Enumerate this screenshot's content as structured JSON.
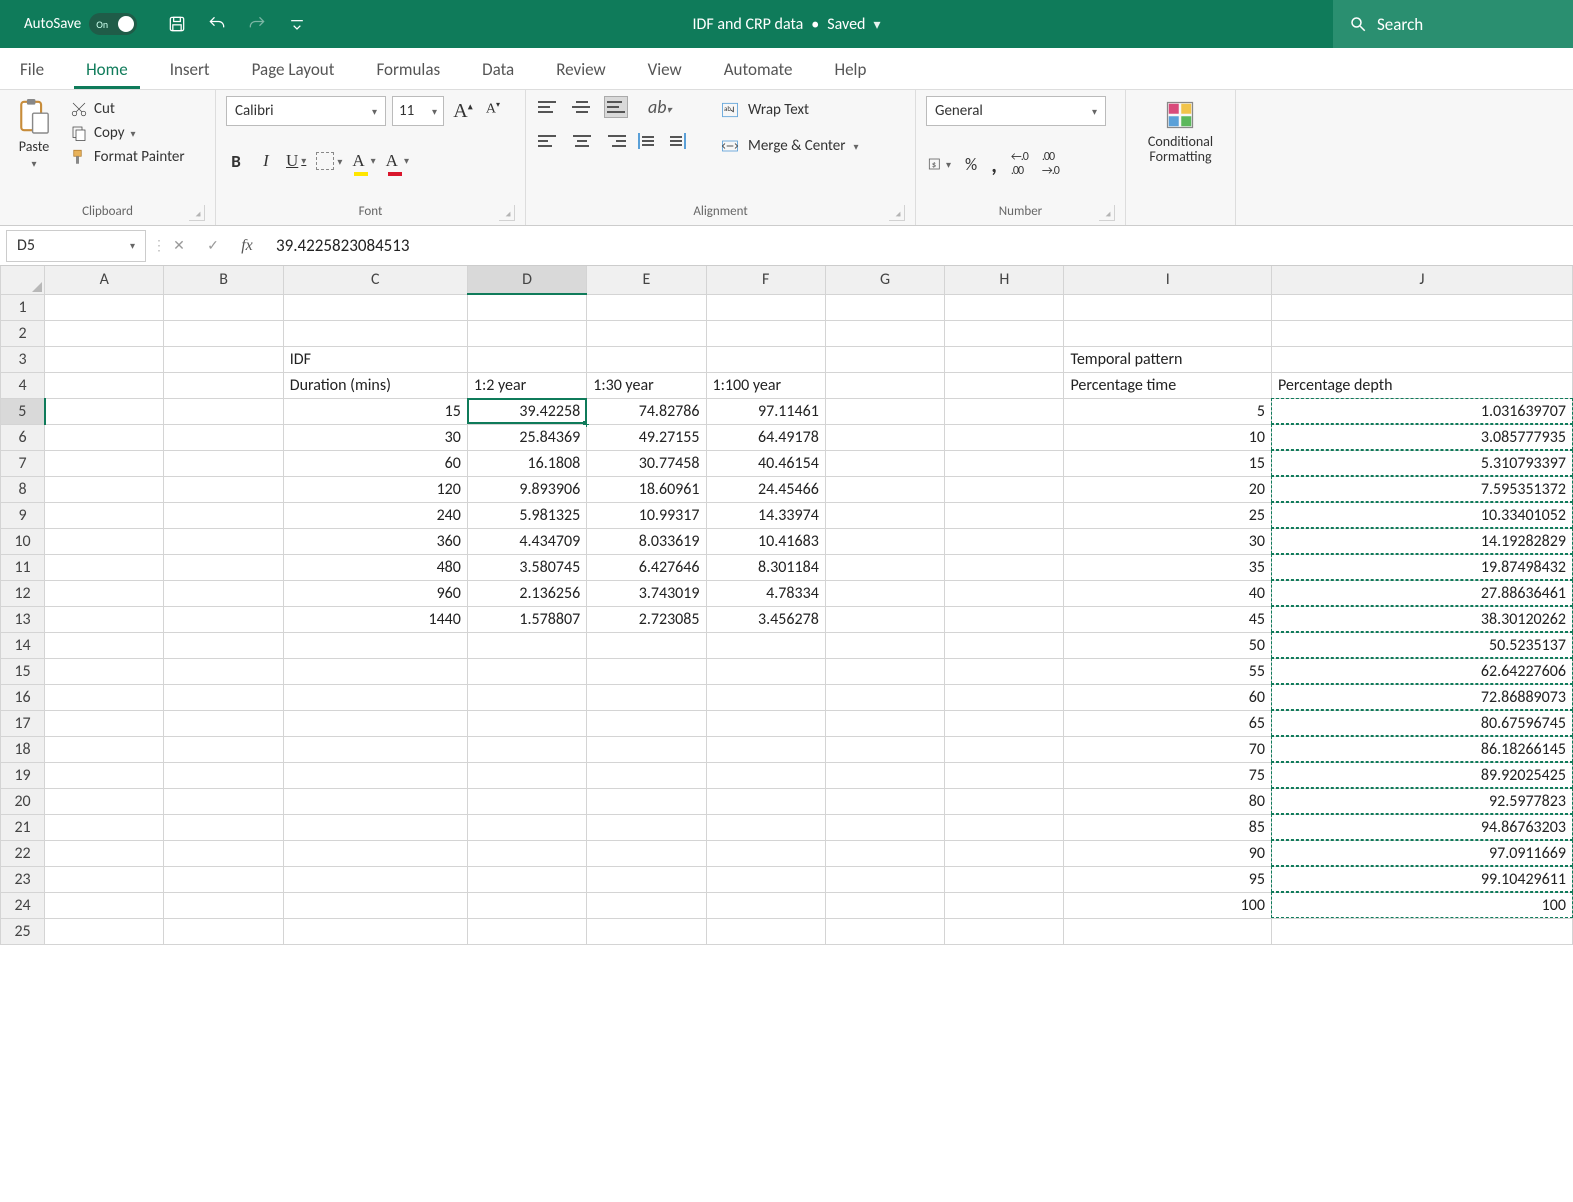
{
  "title_bar": {
    "autosave_label": "AutoSave",
    "autosave_on": "On",
    "doc_name": "IDF and CRP data",
    "doc_status": "Saved",
    "search_placeholder": "Search"
  },
  "ribbon_tabs": [
    "File",
    "Home",
    "Insert",
    "Page Layout",
    "Formulas",
    "Data",
    "Review",
    "View",
    "Automate",
    "Help"
  ],
  "active_tab": "Home",
  "ribbon": {
    "clipboard": {
      "paste": "Paste",
      "cut": "Cut",
      "copy": "Copy",
      "format_painter": "Format Painter",
      "group_label": "Clipboard"
    },
    "font": {
      "name": "Calibri",
      "size": "11",
      "group_label": "Font"
    },
    "alignment": {
      "wrap": "Wrap Text",
      "merge": "Merge & Center",
      "group_label": "Alignment"
    },
    "number": {
      "format": "General",
      "group_label": "Number"
    },
    "cond": {
      "label": "Conditional\nFormatting"
    }
  },
  "formula_bar": {
    "name_box": "D5",
    "value": "39.4225823084513"
  },
  "columns": [
    "A",
    "B",
    "C",
    "D",
    "E",
    "F",
    "G",
    "H",
    "I",
    "J"
  ],
  "selected_col": "D",
  "selected_row": 5,
  "rows": [
    {
      "r": 1
    },
    {
      "r": 2
    },
    {
      "r": 3,
      "C": {
        "v": "IDF",
        "t": true
      },
      "I": {
        "v": "Temporal pattern",
        "t": true
      }
    },
    {
      "r": 4,
      "C": {
        "v": "Duration (mins)",
        "t": true
      },
      "D": {
        "v": "1:2 year",
        "t": true
      },
      "E": {
        "v": "1:30 year",
        "t": true
      },
      "F": {
        "v": "1:100 year",
        "t": true
      },
      "I": {
        "v": "Percentage time",
        "t": true
      },
      "J": {
        "v": "Percentage depth",
        "t": true
      }
    },
    {
      "r": 5,
      "C": {
        "v": "15"
      },
      "D": {
        "v": "39.42258",
        "sel": true
      },
      "E": {
        "v": "74.82786"
      },
      "F": {
        "v": "97.11461"
      },
      "I": {
        "v": "5"
      },
      "J": {
        "v": "1.031639707",
        "m": true
      }
    },
    {
      "r": 6,
      "C": {
        "v": "30"
      },
      "D": {
        "v": "25.84369"
      },
      "E": {
        "v": "49.27155"
      },
      "F": {
        "v": "64.49178"
      },
      "I": {
        "v": "10"
      },
      "J": {
        "v": "3.085777935",
        "m": true
      }
    },
    {
      "r": 7,
      "C": {
        "v": "60"
      },
      "D": {
        "v": "16.1808"
      },
      "E": {
        "v": "30.77458"
      },
      "F": {
        "v": "40.46154"
      },
      "I": {
        "v": "15"
      },
      "J": {
        "v": "5.310793397",
        "m": true
      }
    },
    {
      "r": 8,
      "C": {
        "v": "120"
      },
      "D": {
        "v": "9.893906"
      },
      "E": {
        "v": "18.60961"
      },
      "F": {
        "v": "24.45466"
      },
      "I": {
        "v": "20"
      },
      "J": {
        "v": "7.595351372",
        "m": true
      }
    },
    {
      "r": 9,
      "C": {
        "v": "240"
      },
      "D": {
        "v": "5.981325"
      },
      "E": {
        "v": "10.99317"
      },
      "F": {
        "v": "14.33974"
      },
      "I": {
        "v": "25"
      },
      "J": {
        "v": "10.33401052",
        "m": true
      }
    },
    {
      "r": 10,
      "C": {
        "v": "360"
      },
      "D": {
        "v": "4.434709"
      },
      "E": {
        "v": "8.033619"
      },
      "F": {
        "v": "10.41683"
      },
      "I": {
        "v": "30"
      },
      "J": {
        "v": "14.19282829",
        "m": true
      }
    },
    {
      "r": 11,
      "C": {
        "v": "480"
      },
      "D": {
        "v": "3.580745"
      },
      "E": {
        "v": "6.427646"
      },
      "F": {
        "v": "8.301184"
      },
      "I": {
        "v": "35"
      },
      "J": {
        "v": "19.87498432",
        "m": true
      }
    },
    {
      "r": 12,
      "C": {
        "v": "960"
      },
      "D": {
        "v": "2.136256"
      },
      "E": {
        "v": "3.743019"
      },
      "F": {
        "v": "4.78334"
      },
      "I": {
        "v": "40"
      },
      "J": {
        "v": "27.88636461",
        "m": true
      }
    },
    {
      "r": 13,
      "C": {
        "v": "1440"
      },
      "D": {
        "v": "1.578807"
      },
      "E": {
        "v": "2.723085"
      },
      "F": {
        "v": "3.456278"
      },
      "I": {
        "v": "45"
      },
      "J": {
        "v": "38.30120262",
        "m": true
      }
    },
    {
      "r": 14,
      "I": {
        "v": "50"
      },
      "J": {
        "v": "50.5235137",
        "m": true
      }
    },
    {
      "r": 15,
      "I": {
        "v": "55"
      },
      "J": {
        "v": "62.64227606",
        "m": true
      }
    },
    {
      "r": 16,
      "I": {
        "v": "60"
      },
      "J": {
        "v": "72.86889073",
        "m": true
      }
    },
    {
      "r": 17,
      "I": {
        "v": "65"
      },
      "J": {
        "v": "80.67596745",
        "m": true
      }
    },
    {
      "r": 18,
      "I": {
        "v": "70"
      },
      "J": {
        "v": "86.18266145",
        "m": true
      }
    },
    {
      "r": 19,
      "I": {
        "v": "75"
      },
      "J": {
        "v": "89.92025425",
        "m": true
      }
    },
    {
      "r": 20,
      "I": {
        "v": "80"
      },
      "J": {
        "v": "92.5977823",
        "m": true
      }
    },
    {
      "r": 21,
      "I": {
        "v": "85"
      },
      "J": {
        "v": "94.86763203",
        "m": true
      }
    },
    {
      "r": 22,
      "I": {
        "v": "90"
      },
      "J": {
        "v": "97.0911669",
        "m": true
      }
    },
    {
      "r": 23,
      "I": {
        "v": "95"
      },
      "J": {
        "v": "99.10429611",
        "m": true
      }
    },
    {
      "r": 24,
      "I": {
        "v": "100"
      },
      "J": {
        "v": "100",
        "m": true
      }
    },
    {
      "r": 25
    }
  ]
}
